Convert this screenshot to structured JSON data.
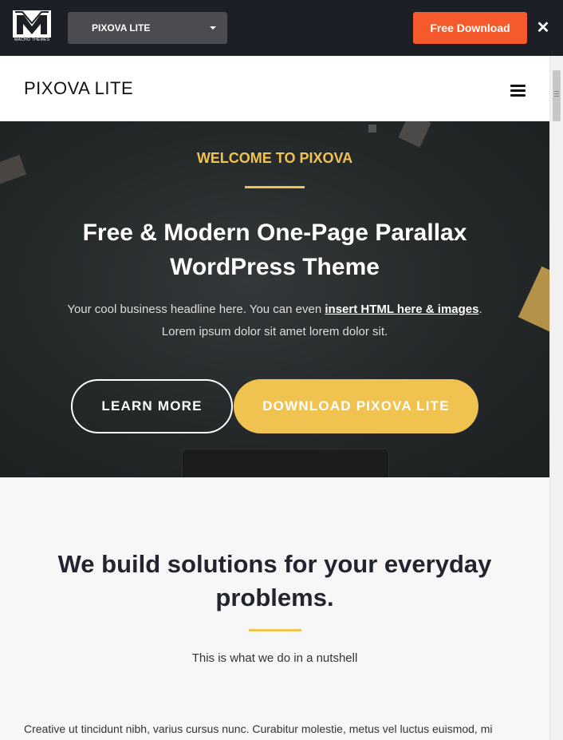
{
  "topbar": {
    "logo_caption": "MACHO THEMES",
    "theme_select": "PIXOVA LITE",
    "free_download": "Free Download",
    "close_glyph": "✕"
  },
  "site": {
    "title": "PIXOVA LITE"
  },
  "hero": {
    "welcome": "WELCOME TO PIXOVA",
    "title": "Free & Modern One-Page Parallax WordPress Theme",
    "sub_before": "Your cool business headline here. You can even ",
    "sub_link": "insert HTML here & images",
    "sub_after": ".",
    "sub_line2": "Lorem ipsum dolor sit amet lorem dolor sit.",
    "learn_more": "LEARN MORE",
    "download": "DOWNLOAD PIXOVA LITE"
  },
  "section": {
    "title": "We build solutions for your everyday problems.",
    "subtitle": "This is what we do in a nutshell",
    "body": "Creative ut tincidunt nibh, varius cursus nunc. Curabitur molestie, metus vel luctus euismod, mi"
  },
  "colors": {
    "accent": "#f0c350",
    "cta": "#f55a2c",
    "topbar": "#1c1f26"
  },
  "icons": [
    "macho-themes-logo",
    "caret-down-icon",
    "close-icon",
    "hamburger-menu-icon"
  ]
}
